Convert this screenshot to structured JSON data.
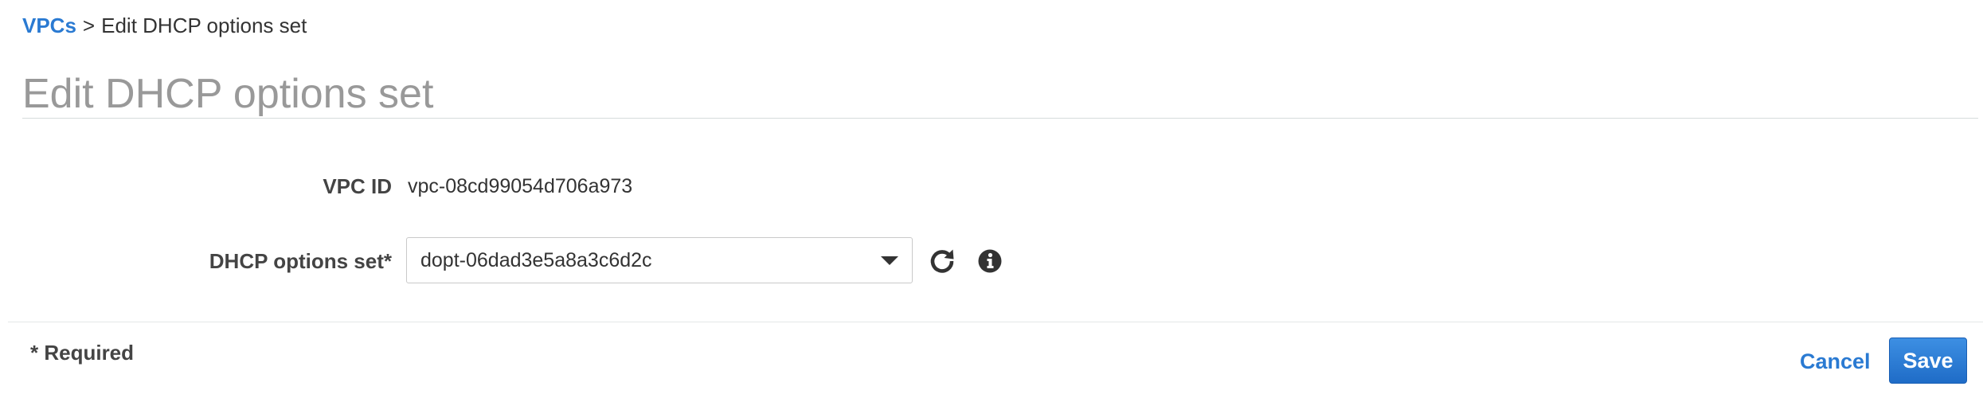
{
  "breadcrumb": {
    "parent_link": "VPCs",
    "separator": ">",
    "current": "Edit DHCP options set"
  },
  "page_title": "Edit DHCP options set",
  "form": {
    "vpc_id": {
      "label": "VPC ID",
      "value": "vpc-08cd99054d706a973"
    },
    "dhcp_options_set": {
      "label": "DHCP options set*",
      "selected_value": "dopt-06dad3e5a8a3c6d2c"
    }
  },
  "icons": {
    "dropdown": "chevron-down-icon",
    "refresh": "refresh-icon",
    "info": "info-icon"
  },
  "footer": {
    "required_note": "* Required",
    "cancel_label": "Cancel",
    "save_label": "Save"
  },
  "colors": {
    "link": "#2a7ad2",
    "primary_button": "#1f6cc7",
    "title_gray": "#999999"
  }
}
